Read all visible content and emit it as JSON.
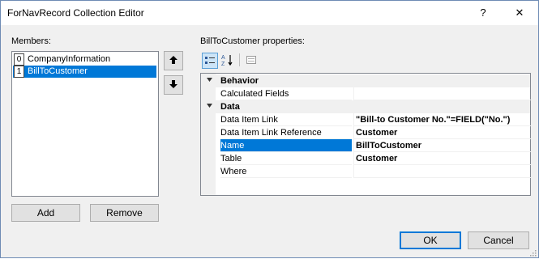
{
  "window": {
    "title": "ForNavRecord Collection Editor",
    "help_glyph": "?",
    "close_glyph": "✕"
  },
  "members": {
    "label": "Members:",
    "items": [
      {
        "index": "0",
        "label": "CompanyInformation",
        "selected": false
      },
      {
        "index": "1",
        "label": "BillToCustomer",
        "selected": true
      }
    ],
    "add_label": "Add",
    "remove_label": "Remove"
  },
  "properties": {
    "label": "BillToCustomer properties:",
    "categories": [
      {
        "name": "Behavior",
        "rows": [
          {
            "name": "Calculated Fields",
            "value": ""
          }
        ]
      },
      {
        "name": "Data",
        "rows": [
          {
            "name": "Data Item Link",
            "value": "\"Bill-to Customer No.\"=FIELD(\"No.\")"
          },
          {
            "name": "Data Item Link Reference",
            "value": "Customer"
          },
          {
            "name": "Name",
            "value": "BillToCustomer",
            "selected": true
          },
          {
            "name": "Table",
            "value": "Customer"
          },
          {
            "name": "Where",
            "value": ""
          }
        ]
      }
    ]
  },
  "footer": {
    "ok_label": "OK",
    "cancel_label": "Cancel"
  },
  "colors": {
    "accent": "#0078d7",
    "dialog_bg": "#f0f0f0"
  }
}
